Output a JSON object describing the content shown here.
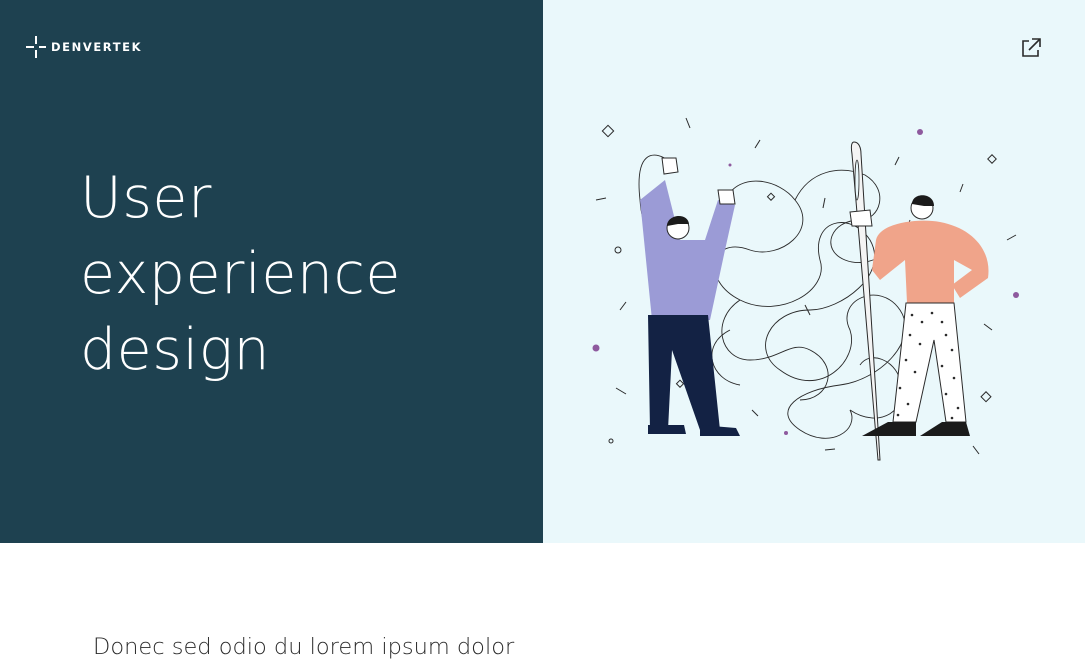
{
  "brand": {
    "name": "DENVERTEK"
  },
  "hero": {
    "title_lines": [
      "User",
      "experience",
      "design"
    ],
    "left_bg": "#1e4150",
    "right_bg": "#eaf8fb"
  },
  "toolbar": {
    "external_link_icon": "external-link-icon"
  },
  "illustration": {
    "subject": "two people untangling a thread through a needle",
    "colors": {
      "shirt_left": "#9b9bd6",
      "pants_left": "#132244",
      "shirt_right": "#f0a48a",
      "dots": "#8e5a9e"
    }
  },
  "content": {
    "intro_text": "Donec sed odio du lorem ipsum dolor"
  }
}
